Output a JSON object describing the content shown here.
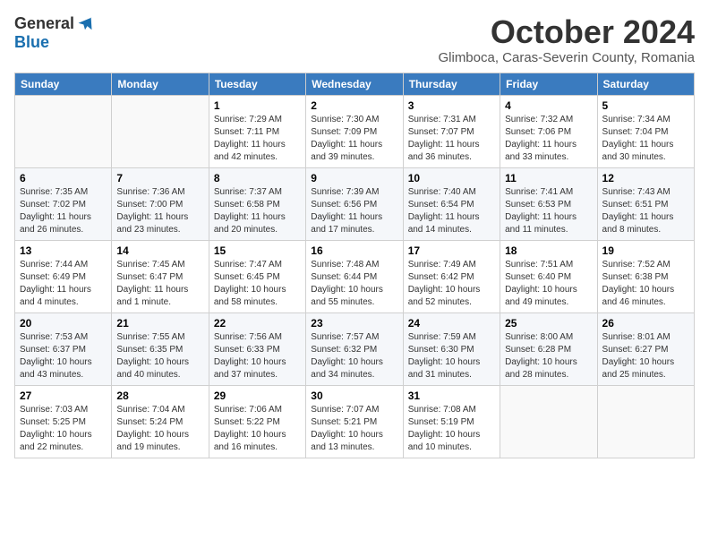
{
  "logo": {
    "general": "General",
    "blue": "Blue"
  },
  "title": "October 2024",
  "subtitle": "Glimboca, Caras-Severin County, Romania",
  "headers": [
    "Sunday",
    "Monday",
    "Tuesday",
    "Wednesday",
    "Thursday",
    "Friday",
    "Saturday"
  ],
  "weeks": [
    [
      {
        "day": "",
        "sunrise": "",
        "sunset": "",
        "daylight": ""
      },
      {
        "day": "",
        "sunrise": "",
        "sunset": "",
        "daylight": ""
      },
      {
        "day": "1",
        "sunrise": "Sunrise: 7:29 AM",
        "sunset": "Sunset: 7:11 PM",
        "daylight": "Daylight: 11 hours and 42 minutes."
      },
      {
        "day": "2",
        "sunrise": "Sunrise: 7:30 AM",
        "sunset": "Sunset: 7:09 PM",
        "daylight": "Daylight: 11 hours and 39 minutes."
      },
      {
        "day": "3",
        "sunrise": "Sunrise: 7:31 AM",
        "sunset": "Sunset: 7:07 PM",
        "daylight": "Daylight: 11 hours and 36 minutes."
      },
      {
        "day": "4",
        "sunrise": "Sunrise: 7:32 AM",
        "sunset": "Sunset: 7:06 PM",
        "daylight": "Daylight: 11 hours and 33 minutes."
      },
      {
        "day": "5",
        "sunrise": "Sunrise: 7:34 AM",
        "sunset": "Sunset: 7:04 PM",
        "daylight": "Daylight: 11 hours and 30 minutes."
      }
    ],
    [
      {
        "day": "6",
        "sunrise": "Sunrise: 7:35 AM",
        "sunset": "Sunset: 7:02 PM",
        "daylight": "Daylight: 11 hours and 26 minutes."
      },
      {
        "day": "7",
        "sunrise": "Sunrise: 7:36 AM",
        "sunset": "Sunset: 7:00 PM",
        "daylight": "Daylight: 11 hours and 23 minutes."
      },
      {
        "day": "8",
        "sunrise": "Sunrise: 7:37 AM",
        "sunset": "Sunset: 6:58 PM",
        "daylight": "Daylight: 11 hours and 20 minutes."
      },
      {
        "day": "9",
        "sunrise": "Sunrise: 7:39 AM",
        "sunset": "Sunset: 6:56 PM",
        "daylight": "Daylight: 11 hours and 17 minutes."
      },
      {
        "day": "10",
        "sunrise": "Sunrise: 7:40 AM",
        "sunset": "Sunset: 6:54 PM",
        "daylight": "Daylight: 11 hours and 14 minutes."
      },
      {
        "day": "11",
        "sunrise": "Sunrise: 7:41 AM",
        "sunset": "Sunset: 6:53 PM",
        "daylight": "Daylight: 11 hours and 11 minutes."
      },
      {
        "day": "12",
        "sunrise": "Sunrise: 7:43 AM",
        "sunset": "Sunset: 6:51 PM",
        "daylight": "Daylight: 11 hours and 8 minutes."
      }
    ],
    [
      {
        "day": "13",
        "sunrise": "Sunrise: 7:44 AM",
        "sunset": "Sunset: 6:49 PM",
        "daylight": "Daylight: 11 hours and 4 minutes."
      },
      {
        "day": "14",
        "sunrise": "Sunrise: 7:45 AM",
        "sunset": "Sunset: 6:47 PM",
        "daylight": "Daylight: 11 hours and 1 minute."
      },
      {
        "day": "15",
        "sunrise": "Sunrise: 7:47 AM",
        "sunset": "Sunset: 6:45 PM",
        "daylight": "Daylight: 10 hours and 58 minutes."
      },
      {
        "day": "16",
        "sunrise": "Sunrise: 7:48 AM",
        "sunset": "Sunset: 6:44 PM",
        "daylight": "Daylight: 10 hours and 55 minutes."
      },
      {
        "day": "17",
        "sunrise": "Sunrise: 7:49 AM",
        "sunset": "Sunset: 6:42 PM",
        "daylight": "Daylight: 10 hours and 52 minutes."
      },
      {
        "day": "18",
        "sunrise": "Sunrise: 7:51 AM",
        "sunset": "Sunset: 6:40 PM",
        "daylight": "Daylight: 10 hours and 49 minutes."
      },
      {
        "day": "19",
        "sunrise": "Sunrise: 7:52 AM",
        "sunset": "Sunset: 6:38 PM",
        "daylight": "Daylight: 10 hours and 46 minutes."
      }
    ],
    [
      {
        "day": "20",
        "sunrise": "Sunrise: 7:53 AM",
        "sunset": "Sunset: 6:37 PM",
        "daylight": "Daylight: 10 hours and 43 minutes."
      },
      {
        "day": "21",
        "sunrise": "Sunrise: 7:55 AM",
        "sunset": "Sunset: 6:35 PM",
        "daylight": "Daylight: 10 hours and 40 minutes."
      },
      {
        "day": "22",
        "sunrise": "Sunrise: 7:56 AM",
        "sunset": "Sunset: 6:33 PM",
        "daylight": "Daylight: 10 hours and 37 minutes."
      },
      {
        "day": "23",
        "sunrise": "Sunrise: 7:57 AM",
        "sunset": "Sunset: 6:32 PM",
        "daylight": "Daylight: 10 hours and 34 minutes."
      },
      {
        "day": "24",
        "sunrise": "Sunrise: 7:59 AM",
        "sunset": "Sunset: 6:30 PM",
        "daylight": "Daylight: 10 hours and 31 minutes."
      },
      {
        "day": "25",
        "sunrise": "Sunrise: 8:00 AM",
        "sunset": "Sunset: 6:28 PM",
        "daylight": "Daylight: 10 hours and 28 minutes."
      },
      {
        "day": "26",
        "sunrise": "Sunrise: 8:01 AM",
        "sunset": "Sunset: 6:27 PM",
        "daylight": "Daylight: 10 hours and 25 minutes."
      }
    ],
    [
      {
        "day": "27",
        "sunrise": "Sunrise: 7:03 AM",
        "sunset": "Sunset: 5:25 PM",
        "daylight": "Daylight: 10 hours and 22 minutes."
      },
      {
        "day": "28",
        "sunrise": "Sunrise: 7:04 AM",
        "sunset": "Sunset: 5:24 PM",
        "daylight": "Daylight: 10 hours and 19 minutes."
      },
      {
        "day": "29",
        "sunrise": "Sunrise: 7:06 AM",
        "sunset": "Sunset: 5:22 PM",
        "daylight": "Daylight: 10 hours and 16 minutes."
      },
      {
        "day": "30",
        "sunrise": "Sunrise: 7:07 AM",
        "sunset": "Sunset: 5:21 PM",
        "daylight": "Daylight: 10 hours and 13 minutes."
      },
      {
        "day": "31",
        "sunrise": "Sunrise: 7:08 AM",
        "sunset": "Sunset: 5:19 PM",
        "daylight": "Daylight: 10 hours and 10 minutes."
      },
      {
        "day": "",
        "sunrise": "",
        "sunset": "",
        "daylight": ""
      },
      {
        "day": "",
        "sunrise": "",
        "sunset": "",
        "daylight": ""
      }
    ]
  ]
}
